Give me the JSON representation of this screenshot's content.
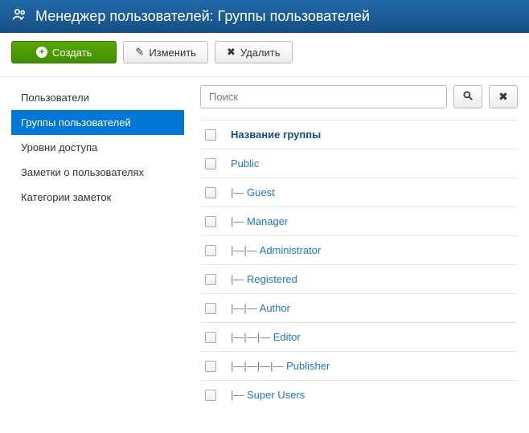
{
  "header": {
    "title": "Менеджер пользователей: Группы пользователей"
  },
  "toolbar": {
    "create": "Создать",
    "edit": "Изменить",
    "delete": "Удалить"
  },
  "sidebar": {
    "items": [
      {
        "label": "Пользователи",
        "active": false
      },
      {
        "label": "Группы пользователей",
        "active": true
      },
      {
        "label": "Уровни доступа",
        "active": false
      },
      {
        "label": "Заметки о пользователях",
        "active": false
      },
      {
        "label": "Категории заметок",
        "active": false
      }
    ]
  },
  "search": {
    "placeholder": "Поиск"
  },
  "table": {
    "header": "Название группы",
    "rows": [
      {
        "prefix": "",
        "name": "Public"
      },
      {
        "prefix": "|— ",
        "name": "Guest"
      },
      {
        "prefix": "|— ",
        "name": "Manager"
      },
      {
        "prefix": "|—|— ",
        "name": "Administrator"
      },
      {
        "prefix": "|— ",
        "name": "Registered"
      },
      {
        "prefix": "|—|— ",
        "name": "Author"
      },
      {
        "prefix": "|—|—|— ",
        "name": "Editor"
      },
      {
        "prefix": "|—|—|—|— ",
        "name": "Publisher"
      },
      {
        "prefix": "|— ",
        "name": "Super Users"
      }
    ]
  }
}
